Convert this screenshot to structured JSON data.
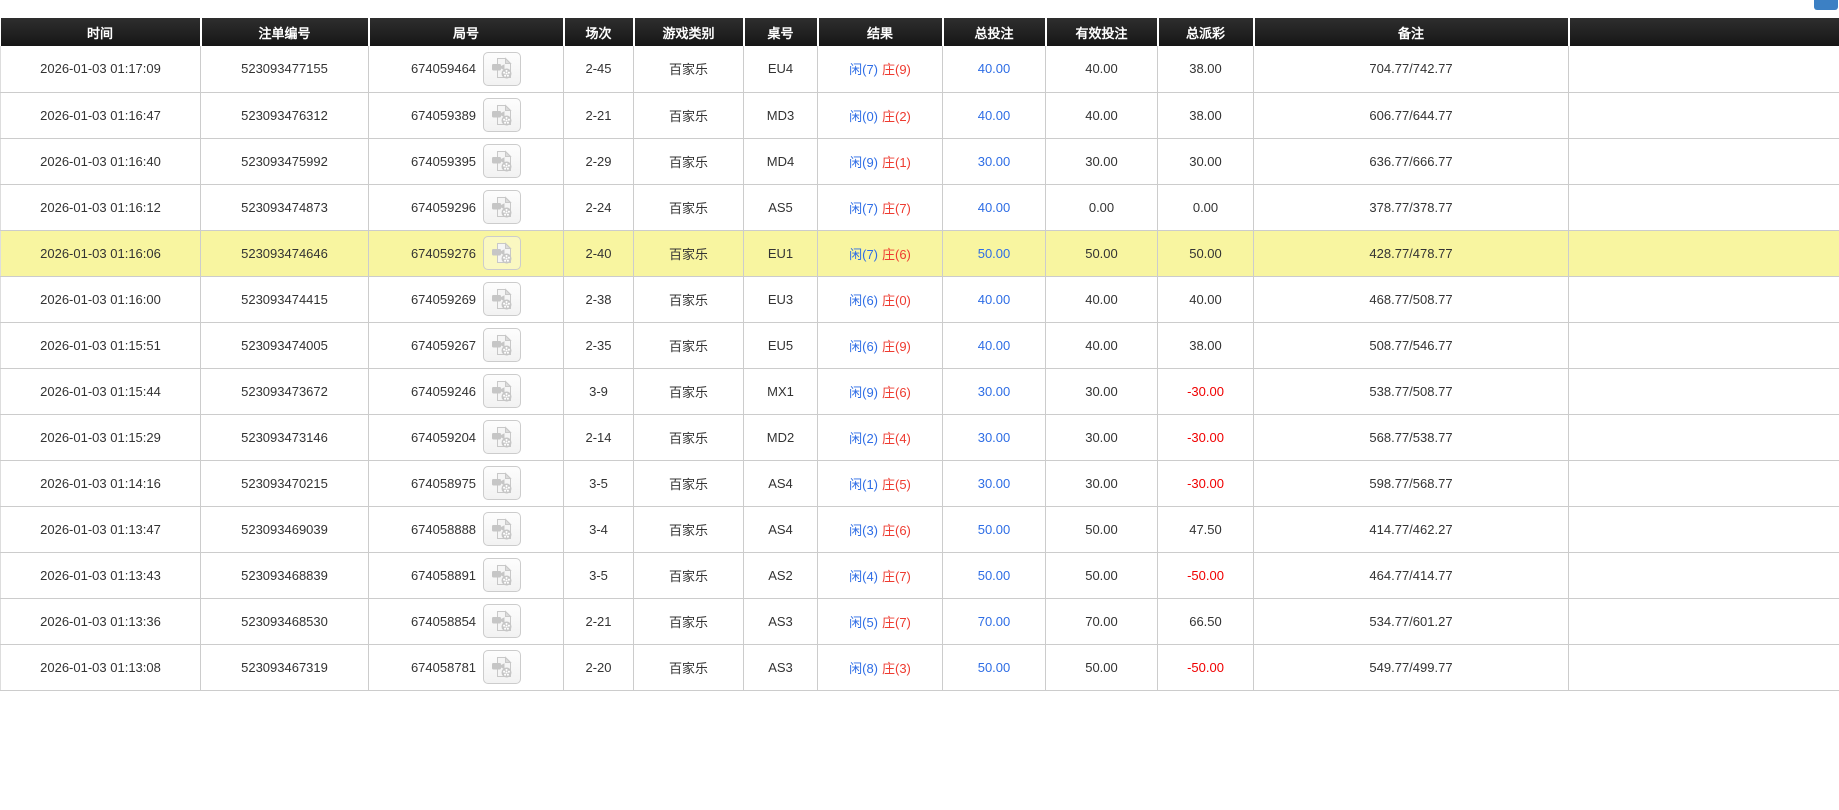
{
  "colors": {
    "link_blue": "#2e6de5",
    "banker_red": "#ee3b30",
    "negative_red": "#f00000",
    "highlight_yellow": "#f8f5a0",
    "header_bg": "#1d1d1d",
    "top_button_blue": "#3c80c4"
  },
  "table": {
    "headers": {
      "time": "时间",
      "bet_id": "注单编号",
      "round": "局号",
      "session": "场次",
      "game_type": "游戏类别",
      "table_no": "桌号",
      "result": "结果",
      "total_bet": "总投注",
      "valid_bet": "有效投注",
      "total_payout": "总派彩",
      "remark": "备注"
    },
    "rows": [
      {
        "time": "2026-01-03 01:17:09",
        "bet_id": "523093477155",
        "round": "674059464",
        "session": "2-45",
        "game_type": "百家乐",
        "table_no": "EU4",
        "player": "闲(7)",
        "banker": "庄(9)",
        "total_bet": "40.00",
        "valid_bet": "40.00",
        "total_payout": "38.00",
        "remark": "704.77/742.77",
        "highlighted": false
      },
      {
        "time": "2026-01-03 01:16:47",
        "bet_id": "523093476312",
        "round": "674059389",
        "session": "2-21",
        "game_type": "百家乐",
        "table_no": "MD3",
        "player": "闲(0)",
        "banker": "庄(2)",
        "total_bet": "40.00",
        "valid_bet": "40.00",
        "total_payout": "38.00",
        "remark": "606.77/644.77",
        "highlighted": false
      },
      {
        "time": "2026-01-03 01:16:40",
        "bet_id": "523093475992",
        "round": "674059395",
        "session": "2-29",
        "game_type": "百家乐",
        "table_no": "MD4",
        "player": "闲(9)",
        "banker": "庄(1)",
        "total_bet": "30.00",
        "valid_bet": "30.00",
        "total_payout": "30.00",
        "remark": "636.77/666.77",
        "highlighted": false
      },
      {
        "time": "2026-01-03 01:16:12",
        "bet_id": "523093474873",
        "round": "674059296",
        "session": "2-24",
        "game_type": "百家乐",
        "table_no": "AS5",
        "player": "闲(7)",
        "banker": "庄(7)",
        "total_bet": "40.00",
        "valid_bet": "0.00",
        "total_payout": "0.00",
        "remark": "378.77/378.77",
        "highlighted": false
      },
      {
        "time": "2026-01-03 01:16:06",
        "bet_id": "523093474646",
        "round": "674059276",
        "session": "2-40",
        "game_type": "百家乐",
        "table_no": "EU1",
        "player": "闲(7)",
        "banker": "庄(6)",
        "total_bet": "50.00",
        "valid_bet": "50.00",
        "total_payout": "50.00",
        "remark": "428.77/478.77",
        "highlighted": true
      },
      {
        "time": "2026-01-03 01:16:00",
        "bet_id": "523093474415",
        "round": "674059269",
        "session": "2-38",
        "game_type": "百家乐",
        "table_no": "EU3",
        "player": "闲(6)",
        "banker": "庄(0)",
        "total_bet": "40.00",
        "valid_bet": "40.00",
        "total_payout": "40.00",
        "remark": "468.77/508.77",
        "highlighted": false
      },
      {
        "time": "2026-01-03 01:15:51",
        "bet_id": "523093474005",
        "round": "674059267",
        "session": "2-35",
        "game_type": "百家乐",
        "table_no": "EU5",
        "player": "闲(6)",
        "banker": "庄(9)",
        "total_bet": "40.00",
        "valid_bet": "40.00",
        "total_payout": "38.00",
        "remark": "508.77/546.77",
        "highlighted": false
      },
      {
        "time": "2026-01-03 01:15:44",
        "bet_id": "523093473672",
        "round": "674059246",
        "session": "3-9",
        "game_type": "百家乐",
        "table_no": "MX1",
        "player": "闲(9)",
        "banker": "庄(6)",
        "total_bet": "30.00",
        "valid_bet": "30.00",
        "total_payout": "-30.00",
        "remark": "538.77/508.77",
        "highlighted": false
      },
      {
        "time": "2026-01-03 01:15:29",
        "bet_id": "523093473146",
        "round": "674059204",
        "session": "2-14",
        "game_type": "百家乐",
        "table_no": "MD2",
        "player": "闲(2)",
        "banker": "庄(4)",
        "total_bet": "30.00",
        "valid_bet": "30.00",
        "total_payout": "-30.00",
        "remark": "568.77/538.77",
        "highlighted": false
      },
      {
        "time": "2026-01-03 01:14:16",
        "bet_id": "523093470215",
        "round": "674058975",
        "session": "3-5",
        "game_type": "百家乐",
        "table_no": "AS4",
        "player": "闲(1)",
        "banker": "庄(5)",
        "total_bet": "30.00",
        "valid_bet": "30.00",
        "total_payout": "-30.00",
        "remark": "598.77/568.77",
        "highlighted": false
      },
      {
        "time": "2026-01-03 01:13:47",
        "bet_id": "523093469039",
        "round": "674058888",
        "session": "3-4",
        "game_type": "百家乐",
        "table_no": "AS4",
        "player": "闲(3)",
        "banker": "庄(6)",
        "total_bet": "50.00",
        "valid_bet": "50.00",
        "total_payout": "47.50",
        "remark": "414.77/462.27",
        "highlighted": false
      },
      {
        "time": "2026-01-03 01:13:43",
        "bet_id": "523093468839",
        "round": "674058891",
        "session": "3-5",
        "game_type": "百家乐",
        "table_no": "AS2",
        "player": "闲(4)",
        "banker": "庄(7)",
        "total_bet": "50.00",
        "valid_bet": "50.00",
        "total_payout": "-50.00",
        "remark": "464.77/414.77",
        "highlighted": false
      },
      {
        "time": "2026-01-03 01:13:36",
        "bet_id": "523093468530",
        "round": "674058854",
        "session": "2-21",
        "game_type": "百家乐",
        "table_no": "AS3",
        "player": "闲(5)",
        "banker": "庄(7)",
        "total_bet": "70.00",
        "valid_bet": "70.00",
        "total_payout": "66.50",
        "remark": "534.77/601.27",
        "highlighted": false
      },
      {
        "time": "2026-01-03 01:13:08",
        "bet_id": "523093467319",
        "round": "674058781",
        "session": "2-20",
        "game_type": "百家乐",
        "table_no": "AS3",
        "player": "闲(8)",
        "banker": "庄(3)",
        "total_bet": "50.00",
        "valid_bet": "50.00",
        "total_payout": "-50.00",
        "remark": "549.77/499.77",
        "highlighted": false
      }
    ]
  }
}
